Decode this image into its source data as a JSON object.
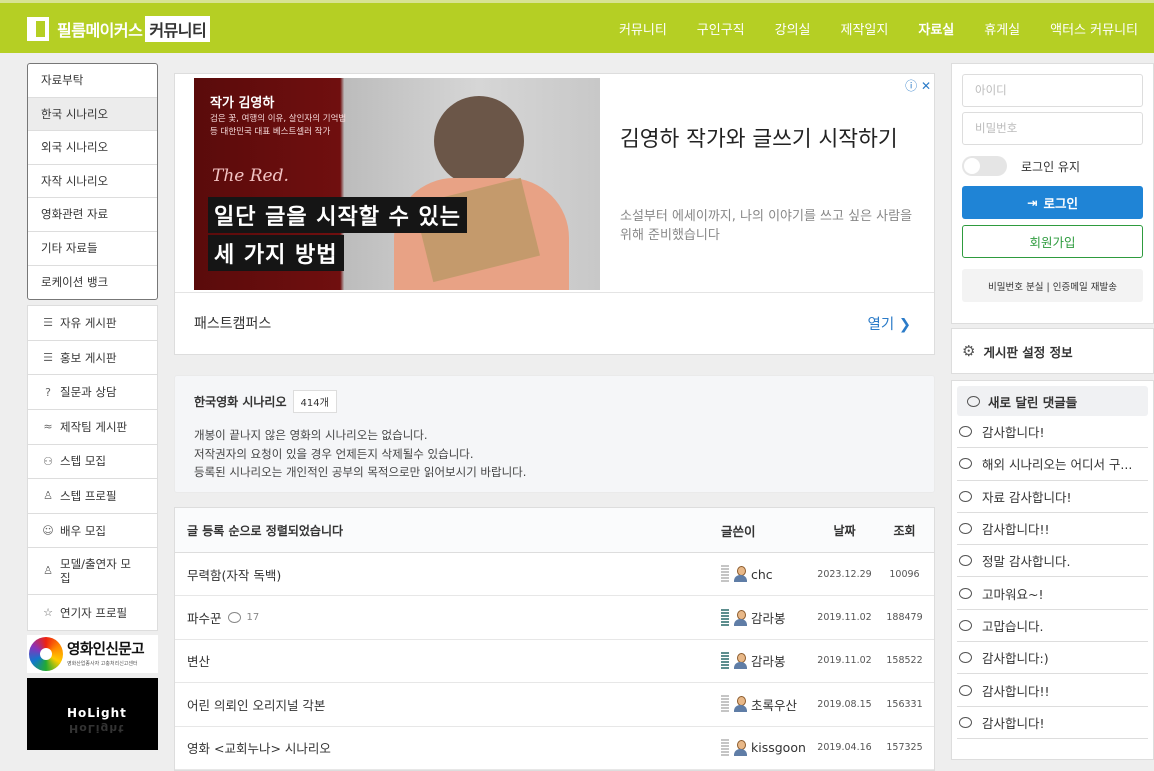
{
  "header": {
    "logo_text": "필름메이커스",
    "logo_badge": "커뮤니티",
    "nav": [
      "커뮤니티",
      "구인구직",
      "강의실",
      "제작일지",
      "자료실",
      "휴게실",
      "액터스 커뮤니티"
    ],
    "active_nav": "자료실"
  },
  "left_sidebar": {
    "categories": [
      "자료부탁",
      "한국 시나리오",
      "외국 시나리오",
      "자작 시나리오",
      "영화관련 자료",
      "기타 자료들",
      "로케이션 뱅크"
    ],
    "selected_category": "한국 시나리오",
    "boards": [
      {
        "label": "자유 게시판",
        "icon": "list-icon"
      },
      {
        "label": "홍보 게시판",
        "icon": "list-icon"
      },
      {
        "label": "질문과 상담",
        "icon": "question-icon"
      },
      {
        "label": "제작팀 게시판",
        "icon": "crew-icon"
      },
      {
        "label": "스텝 모집",
        "icon": "people-icon"
      },
      {
        "label": "스텝 프로필",
        "icon": "profile-icon"
      },
      {
        "label": "배우 모집",
        "icon": "mask-icon"
      },
      {
        "label": "모델/출연자 모집",
        "icon": "model-icon"
      },
      {
        "label": "연기자 프로필",
        "icon": "star-icon"
      }
    ],
    "banner1_text": "영화인신문고",
    "banner1_sub": "영화산업종사자 고충처리신고센터",
    "banner2_text": "HoLight"
  },
  "ad": {
    "image_name": "작가 김영하",
    "image_desc": "검은 꽃, 여행의 이유, 살인자의 기억법 등 대한민국 대표 베스트셀러 작가",
    "image_script": "The Red.",
    "image_headline1": "일단 글을 시작할 수 있는",
    "image_headline2": "세 가지 방법",
    "title": "김영하 작가와 글쓰기 시작하기",
    "subtitle": "소설부터 에세이까지, 나의 이야기를 쓰고 싶은 사람을 위해 준비했습니다",
    "advertiser": "패스트캠퍼스",
    "open_label": "열기",
    "choice_icons": "ⓘ ✕"
  },
  "board_info": {
    "title": "한국영화 시나리오",
    "count": "414개",
    "lines": [
      "개봉이 끝나지 않은 영화의 시나리오는 없습니다.",
      "저작권자의 요청이 있을 경우 언제든지 삭제될수 있습니다.",
      "등록된 시나리오는 개인적인 공부의 목적으로만 읽어보시기 바랍니다."
    ]
  },
  "table": {
    "headers": [
      "글 등록 순으로 정렬되었습니다",
      "글쓴이",
      "날짜",
      "조회"
    ],
    "rows": [
      {
        "title": "무력함(자작 독백)",
        "comments": "",
        "author": "chc",
        "date": "2023.12.29",
        "views": "10096",
        "level": "low"
      },
      {
        "title": "파수꾼",
        "comments": "17",
        "author": "감라봉",
        "date": "2019.11.02",
        "views": "188479",
        "level": "high"
      },
      {
        "title": "변산",
        "comments": "",
        "author": "감라봉",
        "date": "2019.11.02",
        "views": "158522",
        "level": "high"
      },
      {
        "title": "어린 의뢰인 오리지널 각본",
        "comments": "",
        "author": "초록우산",
        "date": "2019.08.15",
        "views": "156331",
        "level": "low"
      },
      {
        "title": "영화 <교회누나> 시나리오",
        "comments": "",
        "author": "kissgoon",
        "date": "2019.04.16",
        "views": "157325",
        "level": "low"
      }
    ]
  },
  "login": {
    "id_placeholder": "아이디",
    "pw_placeholder": "비밀번호",
    "keep_label": "로그인 유지",
    "login_button": "로그인",
    "join_button": "회원가입",
    "find_link": "비밀번호 분실 | 인증메일 재발송"
  },
  "board_settings": "게시판 설정 정보",
  "recent_comments": {
    "title": "새로 달린 댓글들",
    "items": [
      "감사합니다!",
      "해외 시나리오는 어디서 구...",
      "자료 감사합니다!",
      "감사합니다!!",
      "정말 감사합니다.",
      "고마워요~!",
      "고맙습니다.",
      "감사합니다:)",
      "감사합니다!!",
      "감사합니다!"
    ]
  },
  "colors": {
    "header": "#b5cf24",
    "primary": "#1f84d6",
    "join": "#2e9b3e"
  }
}
